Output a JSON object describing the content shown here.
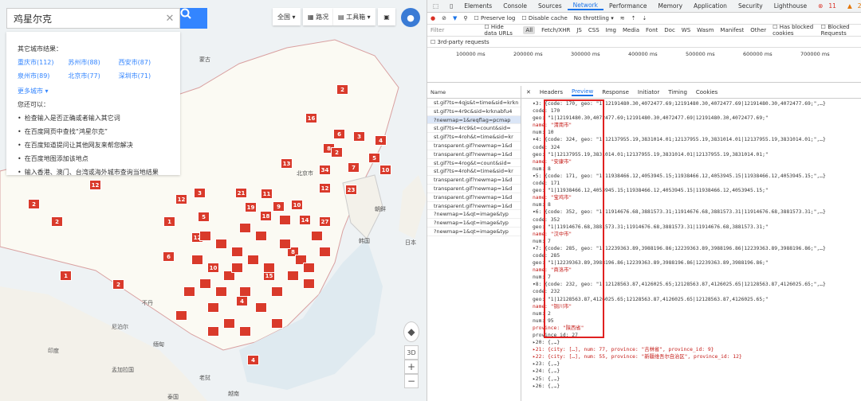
{
  "map": {
    "search_query": "鸡星尔克",
    "panel": {
      "title": "其它城市结果：",
      "cities": [
        {
          "name": "重庆市",
          "count": "(112)"
        },
        {
          "name": "苏州市",
          "count": "(88)"
        },
        {
          "name": "西安市",
          "count": "(87)"
        },
        {
          "name": "泉州市",
          "count": "(89)"
        },
        {
          "name": "北京市",
          "count": "(77)"
        },
        {
          "name": "深圳市",
          "count": "(71)"
        }
      ],
      "more": "更多城市",
      "tip": "您还可以：",
      "tips": [
        "检查输入是否正确或者输入其它词",
        "在百度网页中查找“鸿星尔克”",
        "在百度知道提问让其他网友来帮您解决",
        "在百度地图添加该地点",
        "输入香港、澳门、台湾或海外城市查询当地结果"
      ]
    },
    "toolbar": {
      "region": "全国",
      "route": "路况",
      "tools": "工具箱"
    },
    "labels": {
      "beijing": "北京市",
      "mongolia": "蒙古",
      "chaoxian": "朝鲜",
      "korea": "韩国",
      "nepal": "尼泊尔",
      "india": "印度",
      "bengal": "孟加拉国",
      "myanmar": "缅甸",
      "laos": "老挝",
      "thailand": "泰国",
      "vietnam": "越南",
      "bhutan": "不丹",
      "japan": "日本"
    },
    "ctrl": {
      "d3": "3D",
      "plus": "+",
      "minus": "−"
    },
    "markers": [
      "2",
      "16",
      "6",
      "3",
      "4",
      "8",
      "5",
      "7",
      "10",
      "13",
      "2",
      "12",
      "34",
      "21",
      "19",
      "11",
      "9",
      "18",
      "10",
      "12",
      "23",
      "12",
      "3",
      "14",
      "2",
      "5",
      "2",
      "1",
      "1",
      "4",
      "12",
      "6",
      "2",
      "27",
      "10",
      "4",
      "15",
      "8"
    ]
  },
  "devtools": {
    "tabs": [
      "Elements",
      "Console",
      "Sources",
      "Network",
      "Performance",
      "Memory",
      "Application",
      "Security",
      "Lighthouse"
    ],
    "errors": "11",
    "warnings": "2",
    "info": "1",
    "toolbar": {
      "preserve": "Preserve log",
      "cache": "Disable cache",
      "throttle": "No throttling"
    },
    "filter": {
      "label": "Filter",
      "hide": "Hide data URLs",
      "types": [
        "All",
        "Fetch/XHR",
        "JS",
        "CSS",
        "Img",
        "Media",
        "Font",
        "Doc",
        "WS",
        "Wasm",
        "Manifest",
        "Other"
      ],
      "blocked": "Has blocked cookies",
      "blocked2": "Blocked Requests",
      "third": "3rd-party requests"
    },
    "timeline": [
      "100000 ms",
      "200000 ms",
      "300000 ms",
      "400000 ms",
      "500000 ms",
      "600000 ms",
      "700000 ms"
    ],
    "names_header": "Name",
    "requests": [
      "st.gif?ts=4qjs&t=time&sid=krkn",
      "st.gif?ts=4r9c&sid=krknabfu4",
      "?newmap=1&reqflag=pcmap",
      "st.gif?ts=4rc9&t=count&sid=",
      "st.gif?ts=4roh&t=time&sid=kr",
      "transparent.gif?newmap=1&d",
      "transparent.gif?newmap=1&d",
      "st.gif?ts=4rog&t=count&sid=",
      "st.gif?ts=4roh&t=time&sid=kr",
      "transparent.gif?newmap=1&d",
      "transparent.gif?newmap=1&d",
      "transparent.gif?newmap=1&d",
      "transparent.gif?newmap=1&d",
      "?newmap=1&qt=image&typ",
      "?newmap=1&qt=image&typ",
      "?newmap=1&qt=image&typ"
    ],
    "detail_tabs": [
      "Headers",
      "Preview",
      "Response",
      "Initiator",
      "Timing",
      "Cookies"
    ],
    "code": [
      "▾3: {code: 170, geo: \"1|12191480.30,4072477.69;12191480.30,4072477.69|12191480.30,4072477.69;\",…}",
      "  code: 170",
      "  geo: \"1|12191480.30,4072477.69;12191480.30,4072477.69|12191480.30,4072477.69;\"",
      "  name: \"渭南市\"",
      "  num: 10",
      "▾4: {code: 324, geo: \"1|12137955.19,3831014.01;12137955.19,3831014.01|12137955.19,3831014.01;\",…}",
      "  code: 324",
      "  geo: \"1|12137955.19,3831014.01;12137955.19,3831014.01|12137955.19,3831014.01;\"",
      "  name: \"安康市\"",
      "  num: 8",
      "▾5: {code: 171, geo: \"1|11938466.12,4053945.15;11938466.12,4053945.15|11938466.12,4053945.15;\",…}",
      "  code: 171",
      "  geo: \"1|11938466.12,4053945.15;11938466.12,4053945.15|11938466.12,4053945.15;\"",
      "  name: \"宝鸡市\"",
      "  num: 8",
      "▾6: {code: 352, geo: \"1|11914676.68,3881573.31;11914676.68,3881573.31|11914676.68,3881573.31;\",…}",
      "  code: 352",
      "  geo: \"1|11914676.68,3881573.31;11914676.68,3881573.31|11914676.68,3881573.31;\"",
      "  name: \"汉中市\"",
      "  num: 7",
      "▾7: {code: 285, geo: \"1|12239363.89,3988196.86;12239363.89,3988196.86|12239363.89,3988196.86;\",…}",
      "  code: 285",
      "  geo: \"1|12239363.89,3988196.86;12239363.89,3988196.86|12239363.89,3988196.86;\"",
      "  name: \"商洛市\"",
      "  num: 7",
      "▾8: {code: 232, geo: \"1|12128563.87,4126025.65;12128563.87,4126025.65|12128563.87,4126025.65;\",…}",
      "  code: 232",
      "  geo: \"1|12128563.87,4126025.65;12128563.87,4126025.65|12128563.87,4126025.65;\"",
      "  name: \"铜川市\"",
      "  num: 2",
      "num: 95",
      "province: \"陕西省\"",
      "province_id: 27",
      "▸20: {,…}",
      "▸21: {city: […], num: 77, province: \"吉林省\", province_id: 9}",
      "▸22: {city: […], num: 55, province: \"新疆维吾尔自治区\", province_id: 12}",
      "▸23: {,…}",
      "▸24: {,…}",
      "▸25: {,…}",
      "▸26: {,…}"
    ]
  }
}
